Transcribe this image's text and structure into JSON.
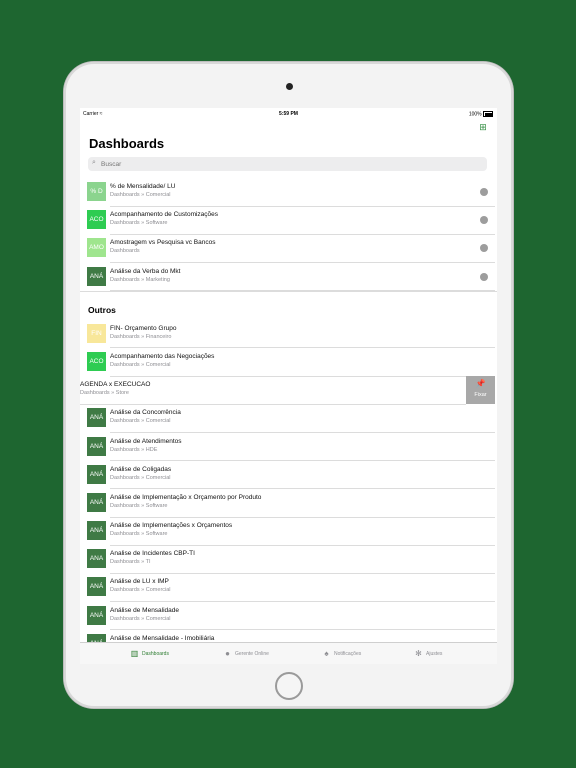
{
  "status": {
    "carrier": "Carrier",
    "time": "5:59 PM",
    "battery": "100%"
  },
  "header": {
    "title": "Dashboards",
    "search_placeholder": "Buscar"
  },
  "favorites": [
    {
      "initials": "% D",
      "color": "#8bd48e",
      "title": "% de Mensalidade/ LU",
      "subtitle": "Dashboards » Comercial"
    },
    {
      "initials": "ACO",
      "color": "#2ecc52",
      "title": "Acompanhamento de Customizações",
      "subtitle": "Dashboards » Software"
    },
    {
      "initials": "AMO",
      "color": "#9fe58e",
      "title": "Amostragem vs Pesquisa vc Bancos",
      "subtitle": "Dashboards"
    },
    {
      "initials": "ANÁ",
      "color": "#3f7a45",
      "title": "Análise da Verba do Mkt",
      "subtitle": "Dashboards » Marketing"
    }
  ],
  "others_section": {
    "title": "Outros",
    "items": [
      {
        "initials": "FIN",
        "color": "#f8e79a",
        "title": "FIN- Orçamento Grupo",
        "subtitle": "Dashboards » Financeiro"
      },
      {
        "initials": "ACO",
        "color": "#2ecc52",
        "title": "Acompanhamento das Negociações",
        "subtitle": "Dashboards » Comercial"
      }
    ],
    "swiped": {
      "title": "AGENDA x EXECUCAO",
      "subtitle": "Dashboards » Store",
      "action_label": "Fixar"
    },
    "more": [
      {
        "initials": "ANÁ",
        "color": "#3f7a45",
        "title": "Análise da Concorrência",
        "subtitle": "Dashboards » Comercial"
      },
      {
        "initials": "ANÁ",
        "color": "#3f7a45",
        "title": "Análise de Atendimentos",
        "subtitle": "Dashboards » HDE"
      },
      {
        "initials": "ANÁ",
        "color": "#3f7a45",
        "title": "Análise de Coligadas",
        "subtitle": "Dashboards » Comercial"
      },
      {
        "initials": "ANÁ",
        "color": "#3f7a45",
        "title": "Análise de Implementação x Orçamento por Produto",
        "subtitle": "Dashboards » Software"
      },
      {
        "initials": "ANÁ",
        "color": "#3f7a45",
        "title": "Análise de Implementações x Orçamentos",
        "subtitle": "Dashboards » Software"
      },
      {
        "initials": "ANA",
        "color": "#3f7a45",
        "title": "Analise de Incidentes CBP-TI",
        "subtitle": "Dashboards » TI"
      },
      {
        "initials": "ANÁ",
        "color": "#3f7a45",
        "title": "Análise de LU x IMP",
        "subtitle": "Dashboards » Comercial"
      },
      {
        "initials": "ANÁ",
        "color": "#3f7a45",
        "title": "Análise de Mensalidade",
        "subtitle": "Dashboards » Comercial"
      },
      {
        "initials": "ANÁ",
        "color": "#3f7a45",
        "title": "Análise de Mensalidade - Imobiliária",
        "subtitle": ""
      }
    ]
  },
  "tabbar": [
    {
      "label": "Dashboards",
      "icon": "chart-icon",
      "active": true
    },
    {
      "label": "Gerente Online",
      "icon": "person-icon",
      "active": false
    },
    {
      "label": "Notificações",
      "icon": "bell-icon",
      "active": false
    },
    {
      "label": "Ajustes",
      "icon": "gear-icon",
      "active": false
    }
  ],
  "colors": {
    "background": "#1e6630",
    "accent": "#2e7d32"
  }
}
